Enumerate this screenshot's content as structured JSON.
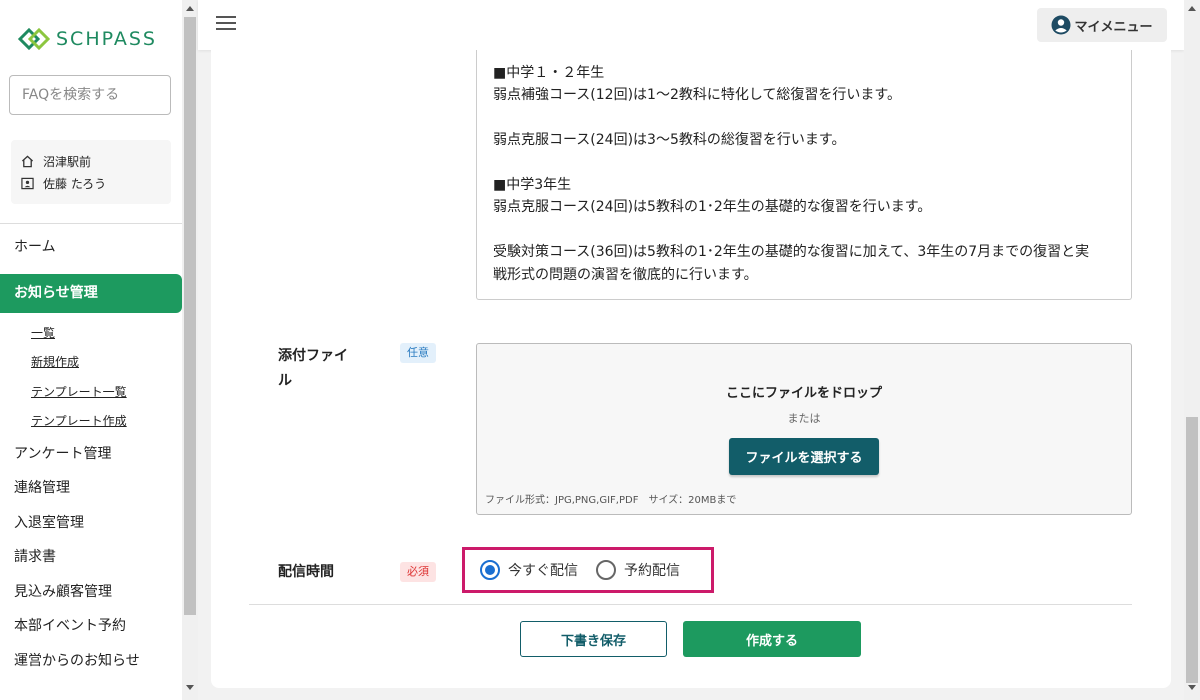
{
  "app": {
    "logo_text": "SCHPASS"
  },
  "sidebar": {
    "search_placeholder": "FAQを検索する",
    "user": {
      "school": "沼津駅前",
      "name": "佐藤 たろう"
    },
    "nav": {
      "home": "ホーム",
      "notice": "お知らせ管理",
      "notice_sub": [
        "一覧",
        "新規作成",
        "テンプレート一覧",
        "テンプレート作成"
      ],
      "survey": "アンケート管理",
      "contact": "連絡管理",
      "entry": "入退室管理",
      "invoice": "請求書",
      "prospect": "見込み顧客管理",
      "hq_event": "本部イベント予約",
      "ops_notice": "運営からのお知らせ"
    }
  },
  "header": {
    "my_menu": "マイメニュー"
  },
  "form": {
    "body_lines": [
      "■中学１・２年生",
      "弱点補強コース(12回)は1〜2教科に特化して総復習を行います。",
      "",
      "弱点克服コース(24回)は3〜5教科の総復習を行います。",
      "",
      "■中学3年生",
      "弱点克服コース(24回)は5教科の1･2年生の基礎的な復習を行います。",
      "",
      "受験対策コース(36回)は5教科の1･2年生の基礎的な復習に加えて、3年生の7月までの復習と実",
      "戦形式の問題の演習を徹底的に行います。"
    ],
    "attachment": {
      "label_line1": "添付ファイ",
      "label_line2": "ル",
      "badge": "任意",
      "drop_title": "ここにファイルをドロップ",
      "or": "または",
      "select_button": "ファイルを選択する",
      "hint": "ファイル形式：JPG,PNG,GIF,PDF　サイズ：20MBまで"
    },
    "delivery": {
      "label": "配信時間",
      "badge": "必須",
      "options": [
        "今すぐ配信",
        "予約配信"
      ],
      "selected": "今すぐ配信"
    },
    "actions": {
      "draft": "下書き保存",
      "create": "作成する"
    }
  },
  "colors": {
    "brand": "#1d9a5f",
    "primary_dark": "#125d69",
    "highlight": "#cc1a6a",
    "radio": "#1a6fd1"
  }
}
